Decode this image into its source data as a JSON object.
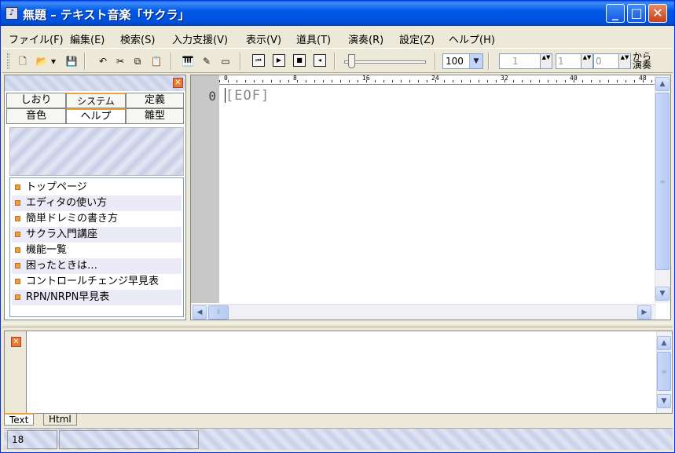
{
  "window": {
    "title": "無題 – テキスト音楽「サクラ」",
    "minimize": "_",
    "maximize": "□",
    "close": "✕",
    "app_icon": "♪"
  },
  "menu": [
    "ファイル(F)",
    "編集(E)",
    "検索(S)",
    "入力支援(V)",
    "表示(V)",
    "道具(T)",
    "演奏(R)",
    "設定(Z)",
    "ヘルプ(H)"
  ],
  "toolbar": {
    "icons": {
      "new": "🗋",
      "open": "📂",
      "dropdown": "▾",
      "save": "💾",
      "undo": "↶",
      "cut": "✂",
      "copy": "⧉",
      "paste": "📋",
      "keyboard": "🎹",
      "edit": "✎",
      "picture": "▭"
    },
    "play_buttons": [
      "⏮",
      "▶",
      "■",
      "◂"
    ],
    "zoom": "100",
    "zoom_arrow": "▼",
    "spin1": "1",
    "spin2": "1",
    "spin3": "0",
    "spin_arrows": "▲▼",
    "kara_line1": "から",
    "kara_line2": "演奏"
  },
  "left_panel": {
    "close": "✕",
    "tabs_row1": [
      "しおり",
      "システム",
      "定義"
    ],
    "tabs_row2": [
      "音色",
      "ヘルプ",
      "雛型"
    ],
    "active_tab": "ヘルプ",
    "help_items": [
      "トップページ",
      "エディタの使い方",
      "簡単ドレミの書き方",
      "サクラ入門講座",
      "機能一覧",
      "困ったときは…",
      "コントロールチェンジ早見表",
      "RPN/NRPN早見表"
    ]
  },
  "editor": {
    "line_number": "0",
    "content": "[EOF]",
    "ruler_marks": [
      "0",
      "8",
      "16",
      "24",
      "32",
      "40",
      "48"
    ]
  },
  "scroll": {
    "up": "▲",
    "down": "▼",
    "left": "◀",
    "right": "▶",
    "grip": "≡",
    "hgrip": "⦀"
  },
  "bottom_panel": {
    "close": "✕",
    "tabs": [
      "Text",
      "Html"
    ]
  },
  "status": {
    "count": "18"
  }
}
